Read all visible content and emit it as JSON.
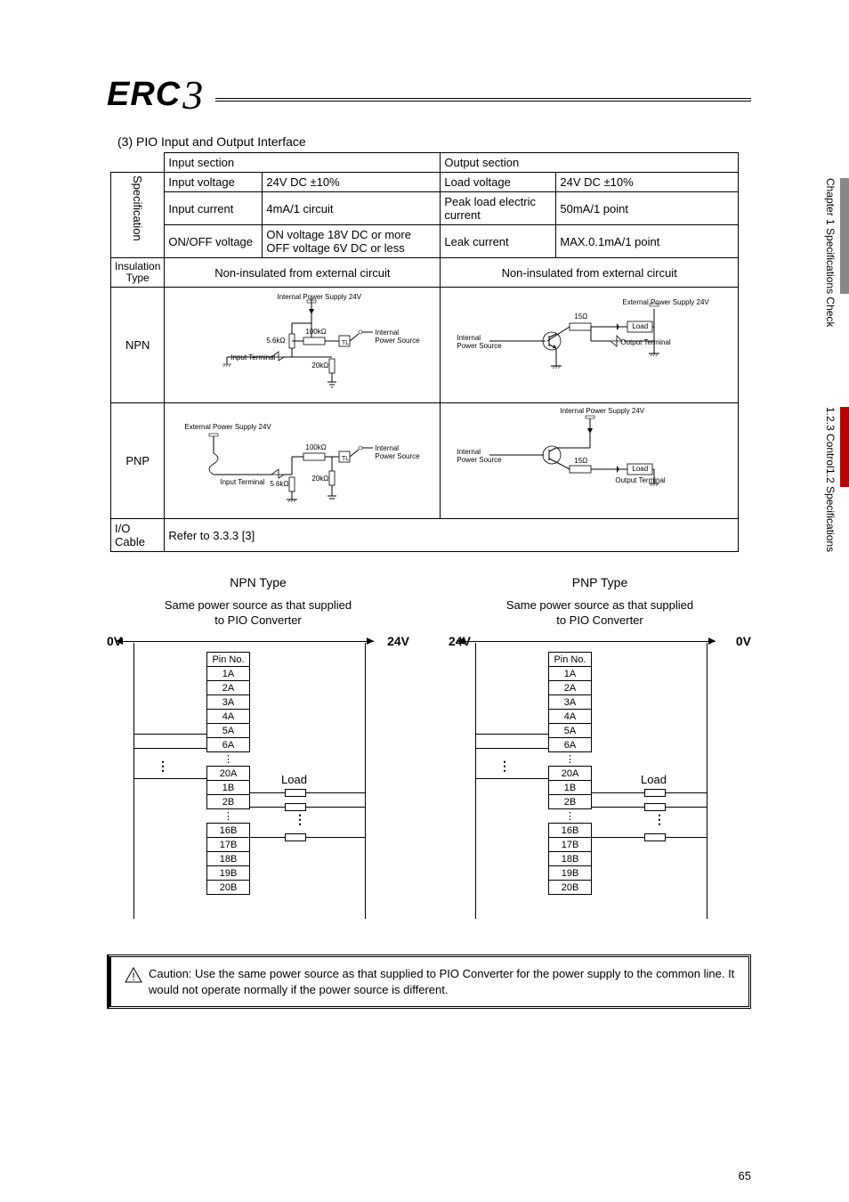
{
  "logo": {
    "brand": "ERC",
    "model": "3"
  },
  "section_title": "(3) PIO Input and Output Interface",
  "table": {
    "input_header": "Input section",
    "output_header": "Output section",
    "spec_label": "Specification",
    "rows": {
      "r1": {
        "a": "Input voltage",
        "b": "24V DC ±10%",
        "c": "Load voltage",
        "d": "24V DC ±10%"
      },
      "r2": {
        "a": "Input current",
        "b": "4mA/1 circuit",
        "c": "Peak load electric current",
        "d": "50mA/1 point"
      },
      "r3": {
        "a": "ON/OFF voltage",
        "b": "ON voltage 18V DC or more\nOFF voltage 6V DC or less",
        "c": "Leak current",
        "d": "MAX.0.1mA/1 point"
      }
    },
    "insulation_label": "Insulation Type",
    "insulation_in": "Non-insulated from external circuit",
    "insulation_out": "Non-insulated from external circuit",
    "npn_label": "NPN",
    "pnp_label": "PNP",
    "io_label": "I/O Cable",
    "io_ref": "Refer to 3.3.3 [3]",
    "circuit_labels": {
      "int_ps_24v": "Internal Power Supply 24V",
      "ext_ps_24v": "External Power Supply 24V",
      "input_term": "Input Terminal",
      "output_term": "Output Terminal",
      "internal_ps": "Internal\nPower Source",
      "r5_6k": "5.6kΩ",
      "r100k": "100kΩ",
      "r20k": "20kΩ",
      "r15": "15Ω",
      "load": "Load"
    }
  },
  "wiring": {
    "npn_title": "NPN Type",
    "pnp_title": "PNP Type",
    "supply_note": "Same power source as that supplied\nto PIO Converter",
    "rails": {
      "zero": "0V",
      "tw": "24V"
    },
    "pin_header": "Pin No.",
    "pins_a": [
      "1A",
      "2A",
      "3A",
      "4A",
      "5A",
      "6A"
    ],
    "pin_20a": "20A",
    "pins_b_top": [
      "1B",
      "2B"
    ],
    "pins_b_bot": [
      "16B",
      "17B",
      "18B",
      "19B",
      "20B"
    ],
    "load": "Load",
    "dots": "⋮"
  },
  "caution": {
    "bang": "!",
    "label": "Caution:",
    "text": "Use the same power source as that supplied to PIO Converter for the power supply to the common line. It would not operate normally if the power source is different."
  },
  "sidebar": {
    "chapter": "Chapter 1 Specifications Check",
    "spec": "1.2 Specifications",
    "control": "1.2.3 Control"
  },
  "page_number": "65"
}
